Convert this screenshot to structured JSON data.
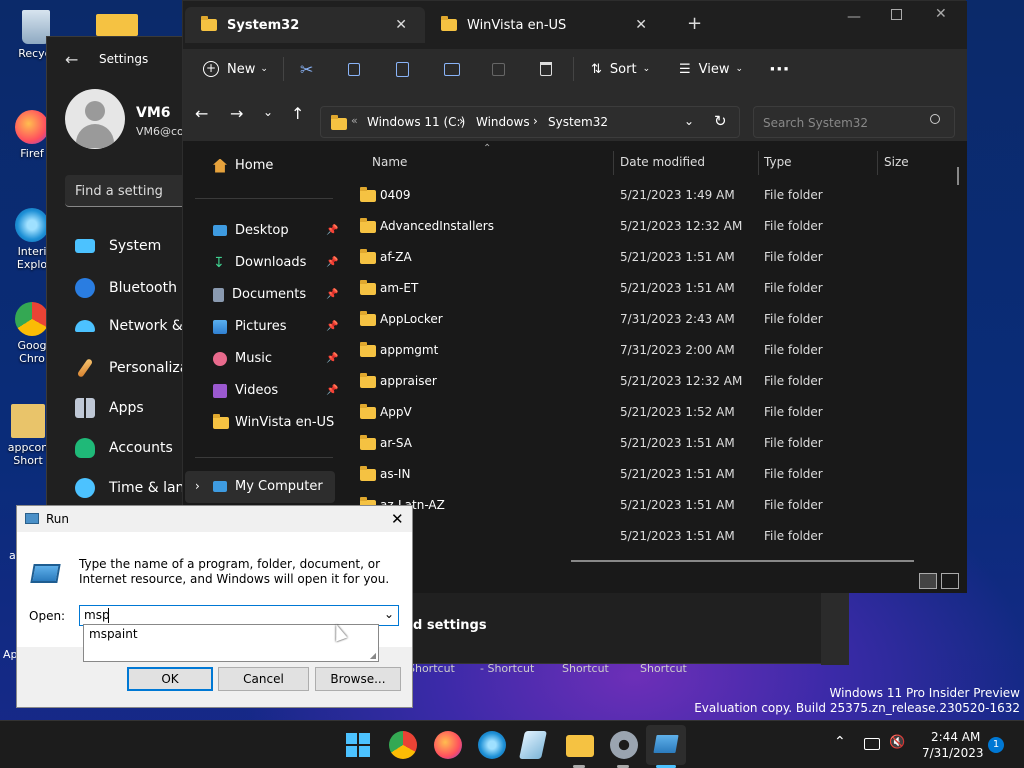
{
  "desktop": {
    "icons": [
      "Recycl",
      "Firef",
      "Interi Explo",
      "Goog Chro",
      "appcon Short"
    ],
    "left_label_a": "a",
    "left_label_ap": "Ap"
  },
  "settings": {
    "title": "Settings",
    "user_name": "VM6",
    "user_email": "VM6@co",
    "search_placeholder": "Find a setting",
    "nav": [
      "System",
      "Bluetooth &",
      "Network & i",
      "Personalizat",
      "Apps",
      "Accounts",
      "Time & lang"
    ]
  },
  "explorer": {
    "tabs": [
      {
        "label": "System32"
      },
      {
        "label": "WinVista en-US"
      }
    ],
    "toolbar": {
      "new": "New",
      "sort": "Sort",
      "view": "View",
      "more": "···"
    },
    "breadcrumb": [
      "Windows 11 (C:)",
      "Windows",
      "System32"
    ],
    "search_placeholder": "Search System32",
    "nav": [
      {
        "label": "Home"
      },
      {
        "label": "Desktop",
        "pinned": true
      },
      {
        "label": "Downloads",
        "pinned": true
      },
      {
        "label": "Documents",
        "pinned": true
      },
      {
        "label": "Pictures",
        "pinned": true
      },
      {
        "label": "Music",
        "pinned": true
      },
      {
        "label": "Videos",
        "pinned": true
      },
      {
        "label": "WinVista en-US"
      },
      {
        "label": "My Computer"
      }
    ],
    "columns": {
      "name": "Name",
      "date": "Date modified",
      "type": "Type",
      "size": "Size"
    },
    "rows": [
      {
        "name": "0409",
        "date": "5/21/2023 1:49 AM",
        "type": "File folder"
      },
      {
        "name": "AdvancedInstallers",
        "date": "5/21/2023 12:32 AM",
        "type": "File folder"
      },
      {
        "name": "af-ZA",
        "date": "5/21/2023 1:51 AM",
        "type": "File folder"
      },
      {
        "name": "am-ET",
        "date": "5/21/2023 1:51 AM",
        "type": "File folder"
      },
      {
        "name": "AppLocker",
        "date": "7/31/2023 2:43 AM",
        "type": "File folder"
      },
      {
        "name": "appmgmt",
        "date": "7/31/2023 2:00 AM",
        "type": "File folder"
      },
      {
        "name": "appraiser",
        "date": "5/21/2023 12:32 AM",
        "type": "File folder"
      },
      {
        "name": "AppV",
        "date": "5/21/2023 1:52 AM",
        "type": "File folder"
      },
      {
        "name": "ar-SA",
        "date": "5/21/2023 1:51 AM",
        "type": "File folder"
      },
      {
        "name": "as-IN",
        "date": "5/21/2023 1:51 AM",
        "type": "File folder"
      },
      {
        "name": "az-Latn-AZ",
        "date": "5/21/2023 1:51 AM",
        "type": "File folder"
      },
      {
        "name": "",
        "date": "5/21/2023 1:51 AM",
        "type": "File folder"
      }
    ]
  },
  "background_window": {
    "heading": "d settings",
    "shortcuts": [
      "Shortcut",
      "- Shortcut",
      "Shortcut",
      "Shortcut"
    ]
  },
  "run": {
    "title": "Run",
    "description": "Type the name of a program, folder, document, or Internet resource, and Windows will open it for you.",
    "open_label": "Open:",
    "input_value": "msp",
    "suggestion": "mspaint",
    "ok": "OK",
    "cancel": "Cancel",
    "browse": "Browse..."
  },
  "watermark": {
    "line1": "Windows 11 Pro Insider Preview",
    "line2": "Evaluation copy. Build 25375.zn_release.230520-1632"
  },
  "taskbar": {
    "time": "2:44 AM",
    "date": "7/31/2023",
    "notification_count": "1"
  },
  "colors": {
    "accent": "#0078d4",
    "folder": "#f5c242",
    "dark_bg": "#191919"
  }
}
